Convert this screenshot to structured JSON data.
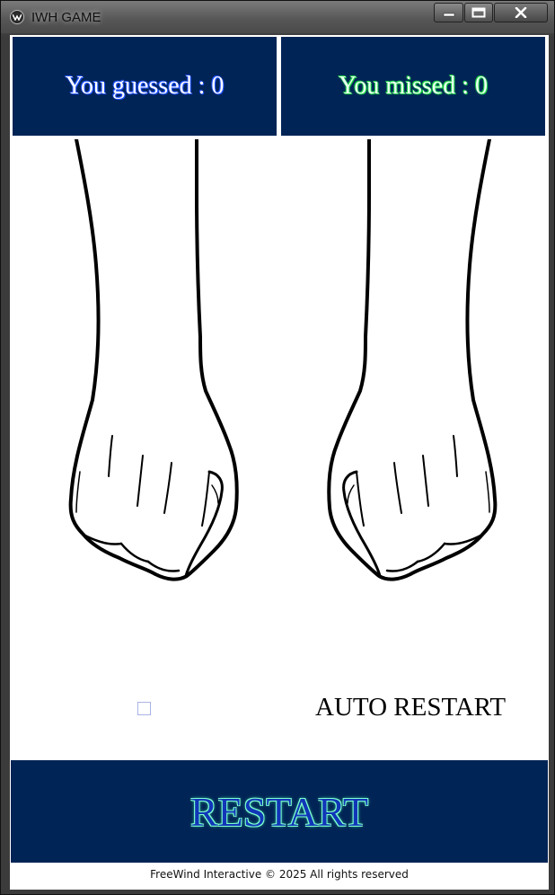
{
  "window": {
    "title": "IWH GAME",
    "controls": [
      "minimize-icon",
      "maximize-icon",
      "close-icon"
    ]
  },
  "scoreboard": {
    "guessed_label": "You guessed : 0",
    "missed_label": "You missed : 0",
    "panel_color": "#002456",
    "guessed_glow_color": "#2457ff",
    "missed_glow_color": "#19c940"
  },
  "hands": {
    "left": "fist-left-icon",
    "right": "fist-right-icon"
  },
  "options": {
    "auto_restart_checked": false,
    "auto_restart_label": "AUTO RESTART"
  },
  "actions": {
    "restart_label": "RESTART"
  },
  "footer": {
    "copyright": "FreeWind Interactive © 2025 All rights reserved"
  }
}
